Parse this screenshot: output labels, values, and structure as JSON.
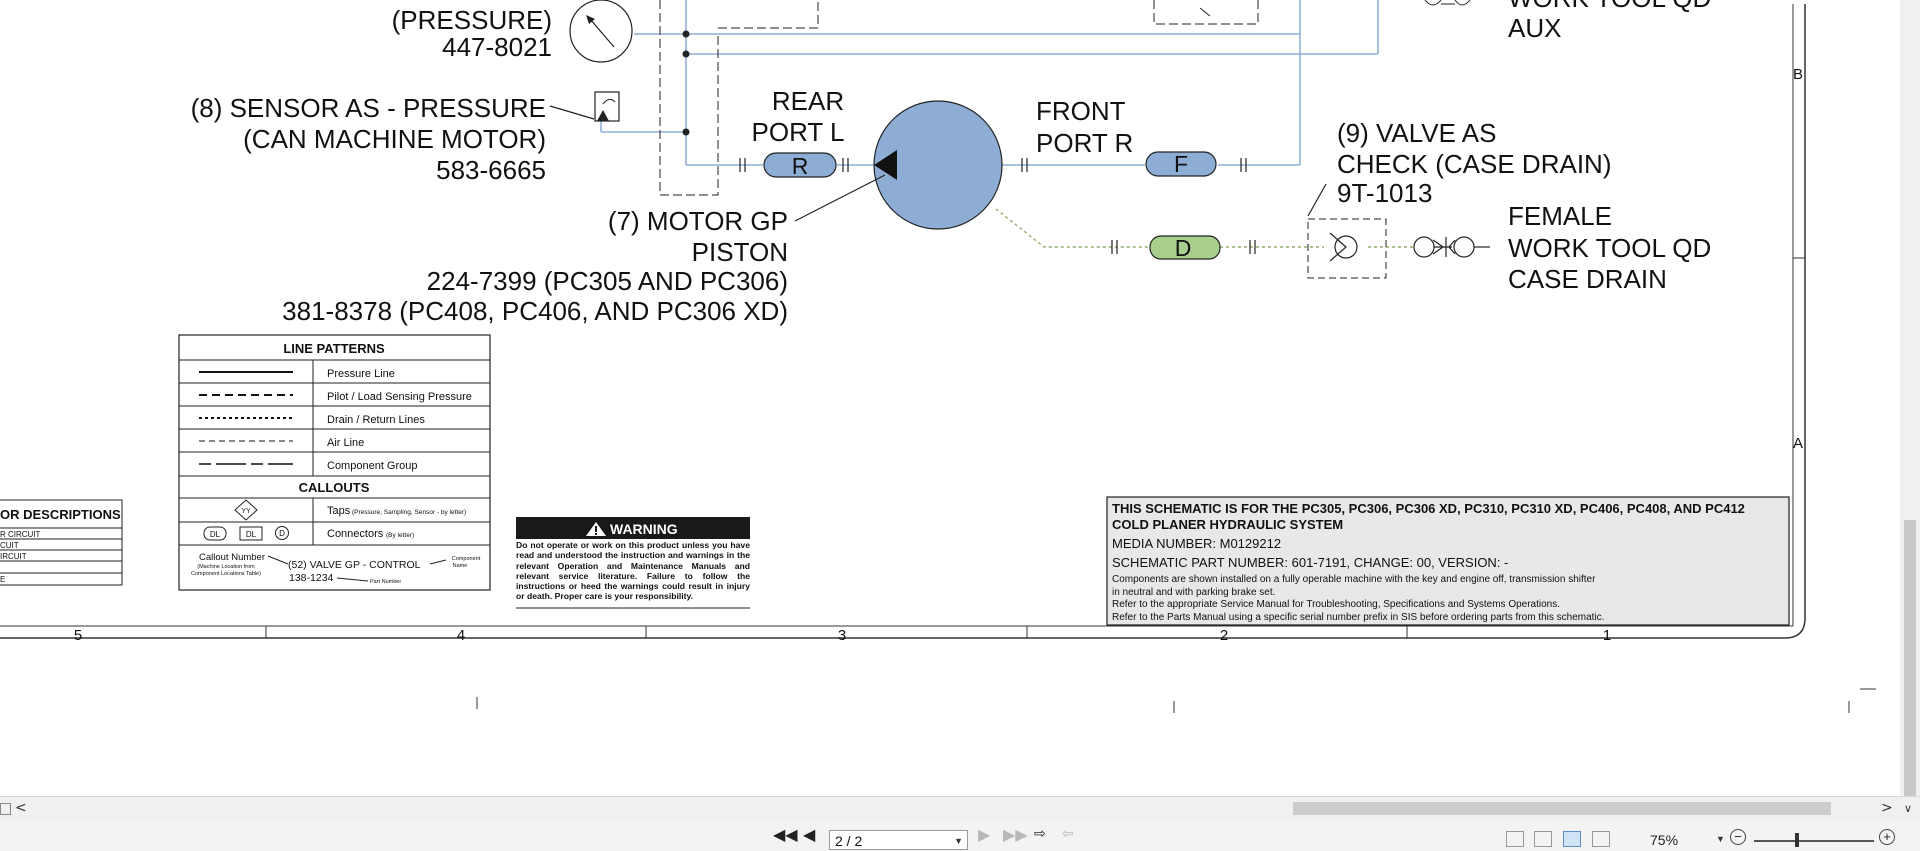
{
  "schematic": {
    "pressure_label": "(PRESSURE)",
    "pressure_part": "447-8021",
    "aux_top": "WORK TOOL QD",
    "aux_bottom": "AUX",
    "sensor_line1": "(8) SENSOR AS - PRESSURE",
    "sensor_line2": "(CAN MACHINE MOTOR)",
    "sensor_part": "583-6665",
    "rear_port_line1": "REAR",
    "rear_port_line2": "PORT L",
    "front_port_line1": "FRONT",
    "front_port_line2": "PORT R",
    "connector_r": "R",
    "connector_f": "F",
    "connector_d": "D",
    "valve_line1": "(9) VALVE AS",
    "valve_line2": "CHECK (CASE DRAIN)",
    "valve_part": "9T-1013",
    "female_line1": "FEMALE",
    "female_line2": "WORK TOOL QD",
    "female_line3": "CASE DRAIN",
    "motor_line1": "(7) MOTOR GP",
    "motor_line2": "PISTON",
    "motor_part1": "224-7399 (PC305 AND PC306)",
    "motor_part2": "381-8378 (PC408, PC406, AND PC306 XD)",
    "zone_b": "B",
    "zone_a": "A"
  },
  "line_patterns": {
    "title": "LINE PATTERNS",
    "rows": [
      "Pressure Line",
      "Pilot / Load Sensing Pressure",
      "Drain / Return Lines",
      "Air Line",
      "Component Group"
    ]
  },
  "callouts": {
    "title": "CALLOUTS",
    "taps_label": "Taps",
    "taps_note": "(Pressure, Sampling, Sensor - by letter)",
    "taps_symbol": "YY",
    "connectors_label": "Connectors",
    "connectors_note": "(By letter)",
    "conn_symbol": "DL",
    "conn_d": "D",
    "callout_number": "Callout Number",
    "machine_location": "(Machine Location from",
    "component_locations": "Component Locations Table)",
    "example": "(52) VALVE GP - CONTROL",
    "part_example": "138-1234",
    "component_label1": "Component",
    "component_label2": "Name",
    "part_number_label": "Part Number"
  },
  "color_desc": {
    "title": "OR DESCRIPTIONS",
    "rows": [
      "R CIRCUIT",
      "CUIT",
      "IRCUIT",
      "",
      "E"
    ]
  },
  "warning": {
    "title": "WARNING",
    "body": "Do not operate or work on this product unless you have read and understood the instruction and warnings in the relevant Operation and Maintenance Manuals and relevant service literature. Failure to follow the instructions or heed the warnings could result in injury or death. Proper care is your responsibility."
  },
  "title_block": {
    "line1": "THIS SCHEMATIC IS FOR THE PC305, PC306, PC306 XD, PC310, PC310 XD, PC406, PC408, AND PC412",
    "line2": "COLD PLANER HYDRAULIC SYSTEM",
    "media": "MEDIA NUMBER: M0129212",
    "schematic_part": "SCHEMATIC PART NUMBER: 601-7191, CHANGE: 00, VERSION: -",
    "note1": "Components are shown installed on a fully operable machine with the key and engine off, transmission shifter",
    "note2": "in neutral and with parking brake set.",
    "note3": "Refer to the appropriate Service Manual for Troubleshooting, Specifications and Systems Operations.",
    "note4": "Refer to the Parts Manual using a specific serial number prefix in SIS before ordering parts from this schematic."
  },
  "zones": [
    "5",
    "4",
    "3",
    "2",
    "1"
  ],
  "toolbar": {
    "page_value": "2 / 2",
    "zoom": "75%"
  },
  "colors": {
    "pressure_line": "#8fb0d6",
    "component_fill": "#8eadd5",
    "drain_connector": "#a9cf8d",
    "title_block_bg": "#e8e8e8",
    "warning_bg": "#1a1a1a"
  }
}
